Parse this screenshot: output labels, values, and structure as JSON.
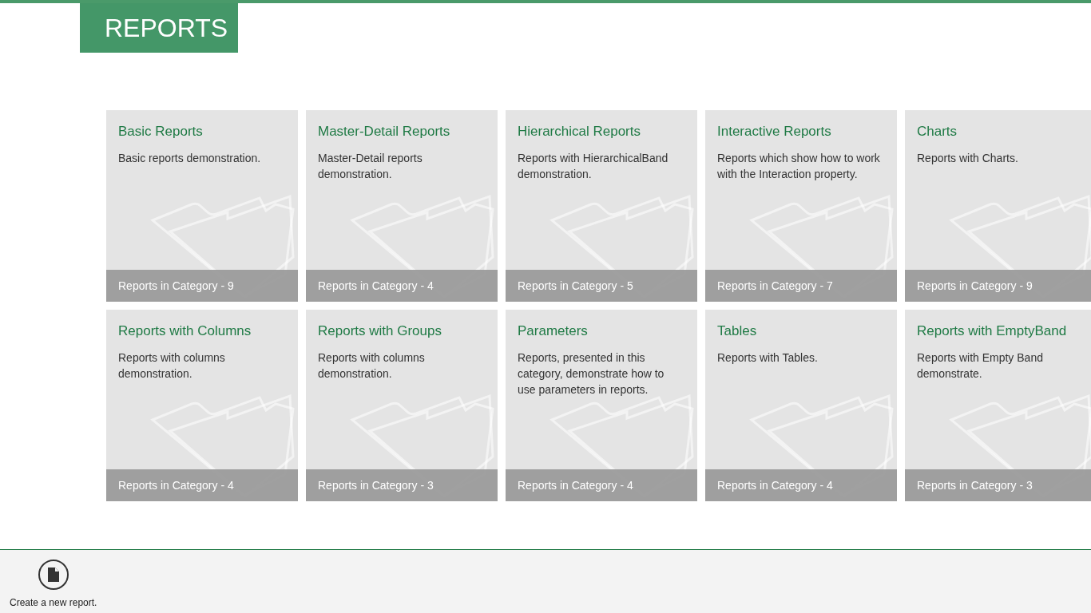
{
  "header": {
    "title": "REPORTS"
  },
  "categories": [
    {
      "title": "Basic Reports",
      "description": "Basic reports demonstration.",
      "count": "Reports in Category - 9"
    },
    {
      "title": "Master-Detail Reports",
      "description": "Master-Detail reports demonstration.",
      "count": "Reports in Category - 4"
    },
    {
      "title": "Hierarchical Reports",
      "description": "Reports with HierarchicalBand demonstration.",
      "count": "Reports in Category - 5"
    },
    {
      "title": "Interactive Reports",
      "description": "Reports which show how to work with the Interaction property.",
      "count": "Reports in Category - 7"
    },
    {
      "title": "Charts",
      "description": "Reports with Charts.",
      "count": "Reports in Category - 9"
    },
    {
      "title": "Reports with Columns",
      "description": "Reports with columns demonstration.",
      "count": "Reports in Category - 4"
    },
    {
      "title": "Reports with Groups",
      "description": "Reports with columns demonstration.",
      "count": "Reports in Category - 3"
    },
    {
      "title": "Parameters",
      "description": "Reports, presented in this category, demonstrate how to use parameters in reports.",
      "count": "Reports in Category - 4"
    },
    {
      "title": "Tables",
      "description": "Reports with Tables.",
      "count": "Reports in Category - 4"
    },
    {
      "title": "Reports with EmptyBand",
      "description": "Reports with Empty Band demonstrate.",
      "count": "Reports in Category - 3"
    }
  ],
  "app_bar": {
    "buttons": [
      {
        "label": "Create a new report."
      }
    ]
  }
}
